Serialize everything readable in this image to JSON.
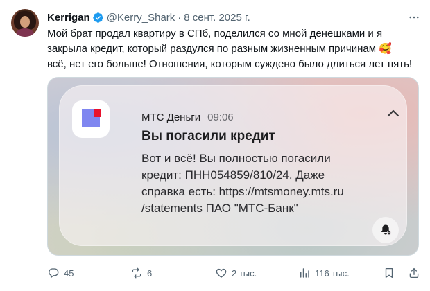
{
  "tweet": {
    "author_name": "Kerrigan",
    "handle": "@Kerry_Shark",
    "separator": "·",
    "date": "8 сент. 2025 г.",
    "text_lines": [
      "Мой брат продал квартиру в СПб, поделился со мной денешками и я",
      "закрыла кредит, который раздулся по разным жизненным причинам 🥰",
      "всё, нет его больше! Отношения, которым суждено было длиться лет пять!"
    ]
  },
  "notification": {
    "app_name": "МТС Деньги",
    "time": "09:06",
    "title": "Вы погасили кредит",
    "body_lines": [
      "Вот и всё! Вы полностью погасили",
      "кредит: ПНН054859/810/24. Даже",
      "справка есть: https://mtsmoney.mts.ru",
      "/statements ПАО \"МТС-Банк\""
    ]
  },
  "actions": {
    "replies": "45",
    "reposts": "6",
    "likes": "2 тыс.",
    "views": "116 тыс."
  },
  "icons": {
    "verified": "verified-badge-icon",
    "more": "more-icon",
    "chevron": "chevron-up-icon",
    "bell": "bell-icon",
    "reply": "reply-icon",
    "repost": "repost-icon",
    "like": "heart-icon",
    "views": "views-icon",
    "bookmark": "bookmark-icon",
    "share": "share-icon"
  },
  "colors": {
    "verified_blue": "#1d9bf0",
    "muted_text": "#536471",
    "mts_purple": "#7f86f0",
    "mts_red": "#e8112d"
  }
}
